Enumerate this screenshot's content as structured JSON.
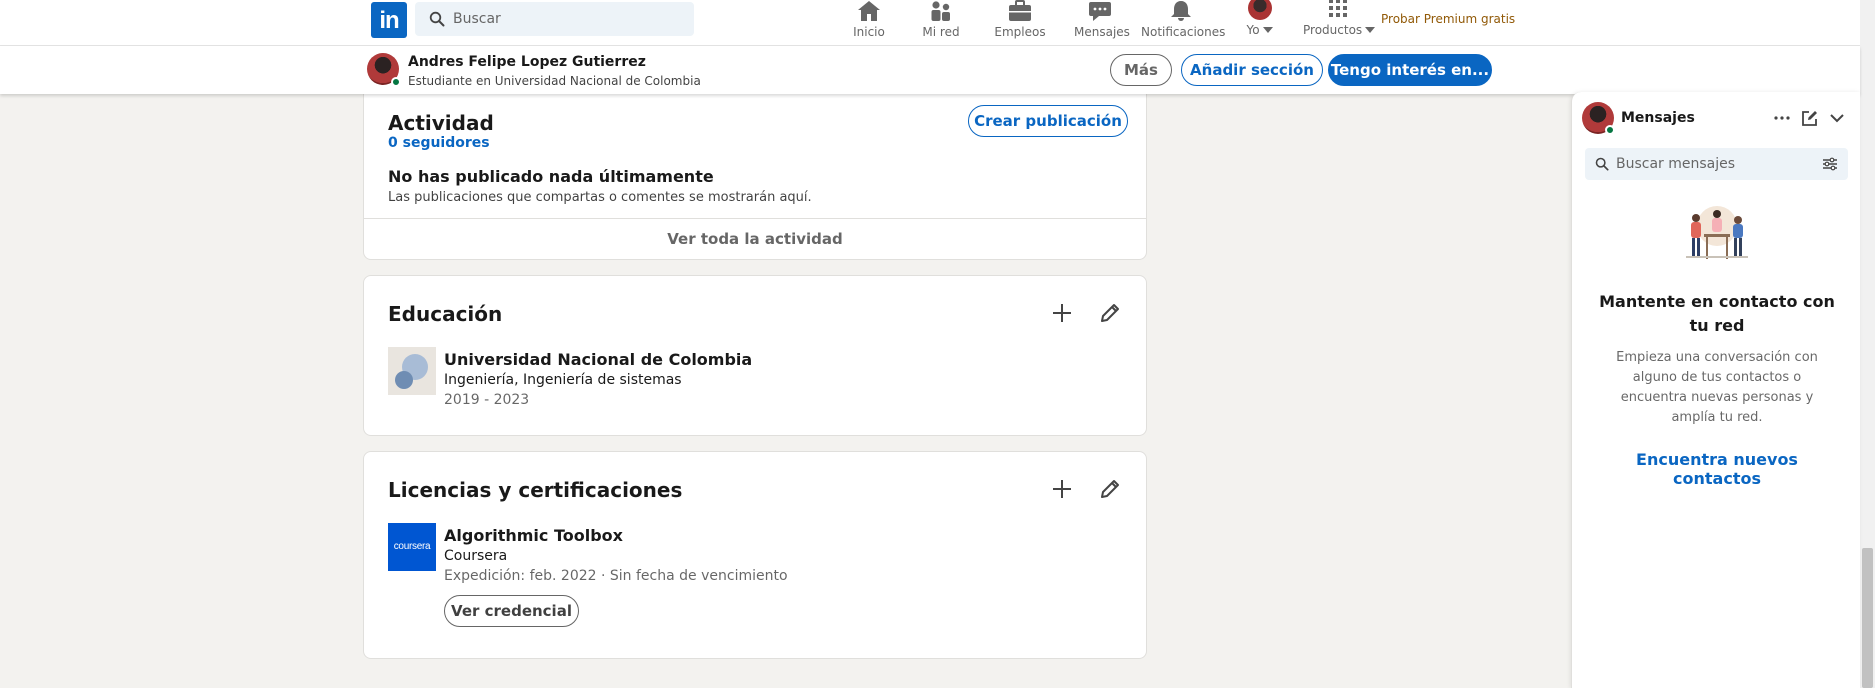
{
  "nav": {
    "logo": "in",
    "search_placeholder": "Buscar",
    "items": [
      {
        "label": "Inicio",
        "icon": "home-icon"
      },
      {
        "label": "Mi red",
        "icon": "network-icon"
      },
      {
        "label": "Empleos",
        "icon": "briefcase-icon"
      },
      {
        "label": "Mensajes",
        "icon": "messaging-icon"
      },
      {
        "label": "Notificaciones",
        "icon": "bell-icon"
      },
      {
        "label": "Yo",
        "icon": "avatar"
      },
      {
        "label": "Productos",
        "icon": "grid-icon"
      }
    ],
    "premium": "Probar Premium gratis"
  },
  "profile_bar": {
    "name": "Andres Felipe Lopez Gutierrez",
    "headline": "Estudiante en Universidad Nacional de Colombia",
    "more_label": "Más",
    "add_section_label": "Añadir sección",
    "open_to_label": "Tengo interés en..."
  },
  "activity": {
    "title": "Actividad",
    "followers": "0 seguidores",
    "create_post_label": "Crear publicación",
    "empty_title": "No has publicado nada últimamente",
    "empty_sub": "Las publicaciones que compartas o comentes se mostrarán aquí.",
    "see_all": "Ver toda la actividad"
  },
  "education": {
    "title": "Educación",
    "entries": [
      {
        "school": "Universidad Nacional de Colombia",
        "degree": "Ingeniería, Ingeniería de sistemas",
        "dates": "2019 - 2023"
      }
    ]
  },
  "licenses": {
    "title": "Licencias y certificaciones",
    "entries": [
      {
        "name": "Algorithmic Toolbox",
        "issuer": "Coursera",
        "logo_text": "coursera",
        "issued": "Expedición: feb. 2022 · Sin fecha de vencimiento",
        "credential_label": "Ver credencial"
      }
    ]
  },
  "messaging": {
    "title": "Mensajes",
    "search_placeholder": "Buscar mensajes",
    "empty_heading": "Mantente en contacto con tu red",
    "empty_body": "Empieza una conversación con alguno de tus contactos o encuentra nuevas personas y amplía tu red.",
    "link": "Encuentra nuevos contactos"
  },
  "colors": {
    "brand_blue": "#0a66c2",
    "premium_gold": "#915907",
    "online_green": "#057642",
    "page_bg": "#f3f2ef"
  }
}
